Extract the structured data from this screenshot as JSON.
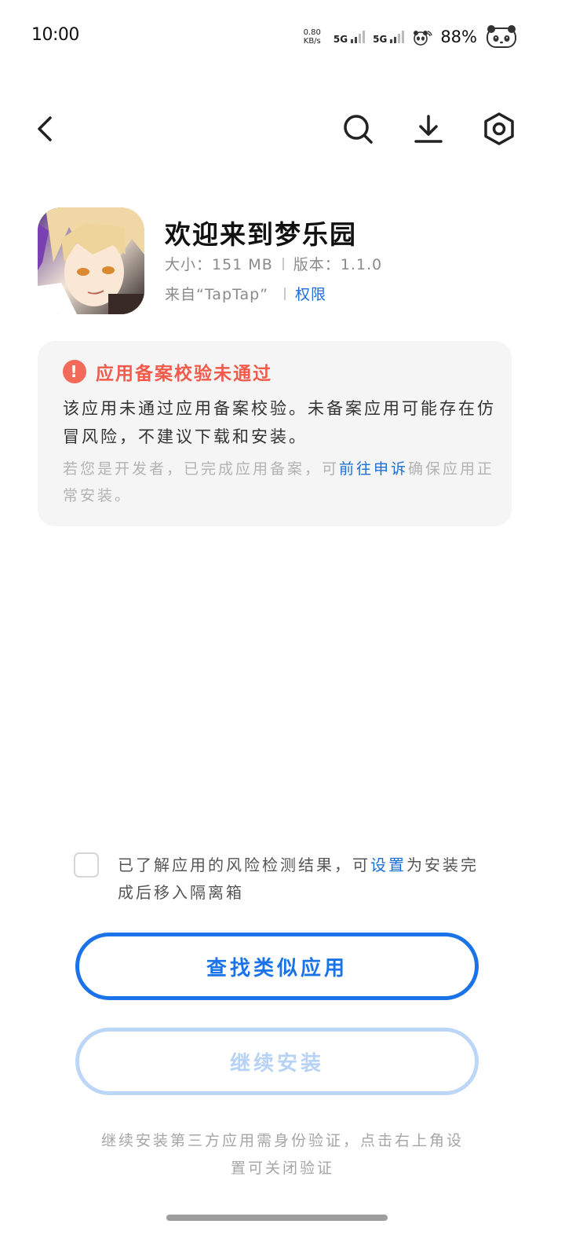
{
  "status_bar": {
    "time": "10:00",
    "net_speed_value": "0.80",
    "net_speed_unit": "KB/s",
    "sim1": "5G",
    "sim2": "5G",
    "battery": "88%"
  },
  "toolbar": {
    "back_icon": "back-arrow-icon",
    "search_icon": "search-icon",
    "download_icon": "download-icon",
    "settings_icon": "settings-hexagon-icon"
  },
  "app": {
    "name": "欢迎来到梦乐园",
    "size": "大小：151 MB",
    "version": "版本：1.1.0",
    "source": "来自“TapTap”",
    "permissions_link": "权限"
  },
  "warning": {
    "title": "应用备案校验未通过",
    "body": "该应用未通过应用备案校验。未备案应用可能存在仿冒风险，不建议下载和安装。",
    "note_prefix": "若您是开发者，已完成应用备案，可",
    "note_link": "前往申诉",
    "note_suffix": "确保应用正常安装。",
    "accent_color": "#f05b4a"
  },
  "acknowledge": {
    "checked": false,
    "text_prefix": "已了解应用的风险检测结果，可",
    "link": "设置",
    "text_suffix": "为安装完成后移入隔离箱"
  },
  "buttons": {
    "find_similar": "查找类似应用",
    "continue_install": "继续安装"
  },
  "footer": {
    "note": "继续安装第三方应用需身份验证，点击右上角设置可关闭验证"
  },
  "colors": {
    "primary": "#1a73e8",
    "primary_disabled": "#bcd6f7"
  }
}
